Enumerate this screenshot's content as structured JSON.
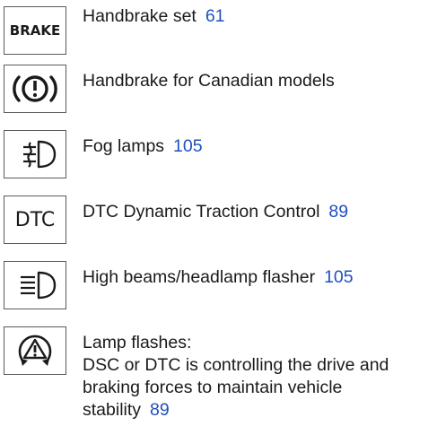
{
  "items": [
    {
      "icon": "brake-text-icon",
      "icon_text": "BRAKE",
      "label": "Handbrake set",
      "page": "61"
    },
    {
      "icon": "circle-exclamation-icon",
      "label": "Handbrake for Canadian models",
      "page": ""
    },
    {
      "icon": "fog-lamp-icon",
      "label": "Fog lamps",
      "page": "105"
    },
    {
      "icon": "dtc-text-icon",
      "icon_text": "DTC",
      "label": "DTC Dynamic Traction Control",
      "page": "89"
    },
    {
      "icon": "high-beam-icon",
      "label": "High beams/headlamp flasher",
      "page": "105"
    },
    {
      "icon": "dsc-triangle-icon",
      "label_line1": "Lamp flashes:",
      "label_line2": "DSC or DTC is controlling the drive and braking forces to maintain vehicle stability",
      "page": "89"
    }
  ],
  "colors": {
    "text": "#1a1a1a",
    "page_ref": "#1f4fbf",
    "icon_border": "#5a5a5a"
  }
}
